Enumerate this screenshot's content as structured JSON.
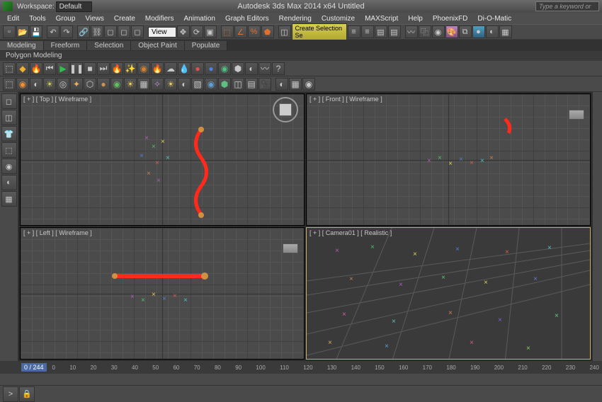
{
  "app": {
    "title": "Autodesk 3ds Max 2014 x64   Untitled",
    "workspace_label": "Workspace:",
    "workspace_value": "Default",
    "search_placeholder": "Type a keyword or"
  },
  "menu": [
    "Edit",
    "Tools",
    "Group",
    "Views",
    "Create",
    "Modifiers",
    "Animation",
    "Graph Editors",
    "Rendering",
    "Customize",
    "MAXScript",
    "Help",
    "PhoenixFD",
    "Di-O-Matic"
  ],
  "toolbar1": {
    "view_label": "View",
    "selection_set": "Create Selection Se"
  },
  "ribbon": {
    "tabs": [
      "Modeling",
      "Freeform",
      "Selection",
      "Object Paint",
      "Populate"
    ],
    "active": 0,
    "panel": "Polygon Modeling"
  },
  "viewports": {
    "top": {
      "label": "[ + ] [ Top ] [ Wireframe ]"
    },
    "front": {
      "label": "[ + ] [ Front ] [ Wireframe ]"
    },
    "left": {
      "label": "[ + ] [ Left ] [ Wireframe ]"
    },
    "camera": {
      "label": "[ + ] [ Camera01 ] [ Realistic ]"
    }
  },
  "time": {
    "current": "0 / 244",
    "ticks": [
      "0",
      "10",
      "20",
      "30",
      "40",
      "50",
      "60",
      "70",
      "80",
      "90",
      "100",
      "110",
      "120",
      "130",
      "140",
      "150",
      "160",
      "170",
      "180",
      "190",
      "200",
      "210",
      "220",
      "230",
      "240"
    ]
  },
  "icons": {
    "new": "▫",
    "open": "📂",
    "save": "💾",
    "undo": "↶",
    "redo": "↷",
    "link": "🔗",
    "unlink": "⛓",
    "select": "◻",
    "move": "✥",
    "rotate": "⟳",
    "scale": "▣",
    "snap": "⬚",
    "angle": "∠",
    "mirror": "◫",
    "align": "≡",
    "layers": "▤",
    "render": "●",
    "fx_play": "▶",
    "fx_pause": "❚❚",
    "fx_stop": "■",
    "fx_fire": "🔥",
    "fx_water": "💧",
    "fx_smoke": "☁",
    "fx_sun": "☀",
    "fx_q": "?",
    "dock1": "◻",
    "dock2": "◫",
    "dock3": "👕",
    "dock4": "⬚",
    "dock5": "◉",
    "dock6": "◐",
    "dock7": "▦"
  },
  "colors": {
    "spline": "#ff2a1a",
    "active_border": "#c8b060"
  }
}
